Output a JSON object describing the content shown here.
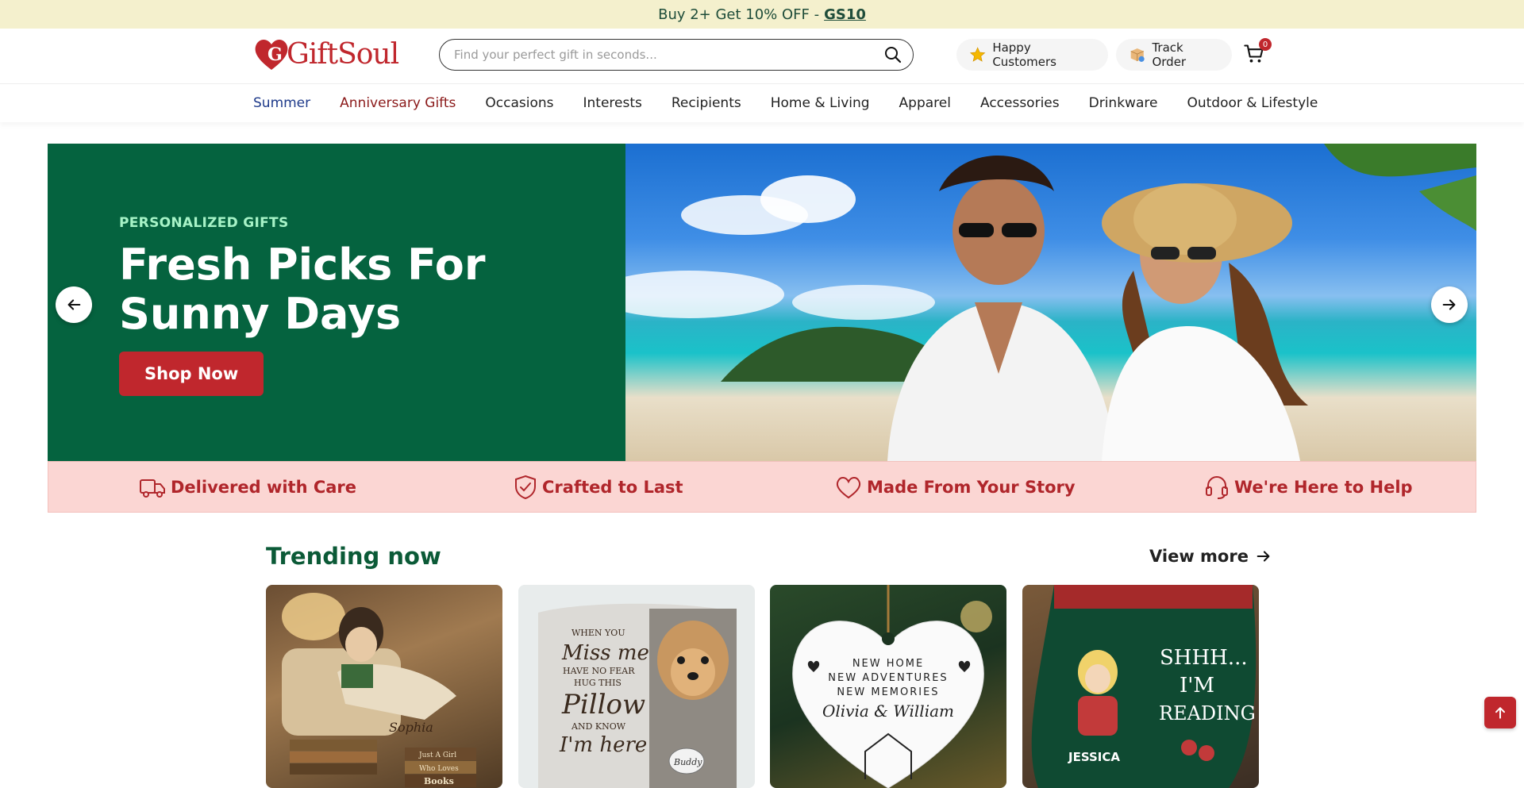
{
  "promo": {
    "text": "Buy 2+ Get 10% OFF -",
    "code": "GS10"
  },
  "header": {
    "logo": "GiftSoul",
    "search_placeholder": "Find your perfect gift in seconds...",
    "happy_customers": "Happy Customers",
    "track_order": "Track Order",
    "cart_count": "0"
  },
  "nav": {
    "items": [
      "Summer",
      "Anniversary Gifts",
      "Occasions",
      "Interests",
      "Recipients",
      "Home & Living",
      "Apparel",
      "Accessories",
      "Drinkware",
      "Outdoor & Lifestyle"
    ]
  },
  "hero": {
    "eyebrow": "PERSONALIZED GIFTS",
    "title": "Fresh Picks For Sunny Days",
    "button": "Shop Now"
  },
  "features": [
    "Delivered with Care",
    "Crafted to Last",
    "Made From Your Story",
    "We're Here to Help"
  ],
  "trending": {
    "title": "Trending now",
    "view_more": "View more",
    "cards": [
      {
        "name_on_item": "Sophia",
        "book_text_1": "Just A Girl",
        "book_text_2": "Who Loves",
        "book_text_3": "Books"
      },
      {
        "line1": "WHEN YOU",
        "line2": "Miss me",
        "line3": "HAVE NO FEAR",
        "line4": "HUG THIS",
        "line5": "Pillow",
        "line6": "AND KNOW",
        "line7": "I'm here",
        "pet_name": "Buddy"
      },
      {
        "line1": "NEW HOME",
        "line2": "NEW ADVENTURES",
        "line3": "NEW MEMORIES",
        "names": "Olivia & William"
      },
      {
        "name": "JESSICA",
        "line1": "SHHH...",
        "line2": "I'M",
        "line3": "READING"
      }
    ]
  },
  "colors": {
    "brand_red": "#c0272d",
    "hero_green": "#05633f",
    "feature_bg": "#fbd6d3",
    "promo_bg": "#f4f0cd"
  }
}
